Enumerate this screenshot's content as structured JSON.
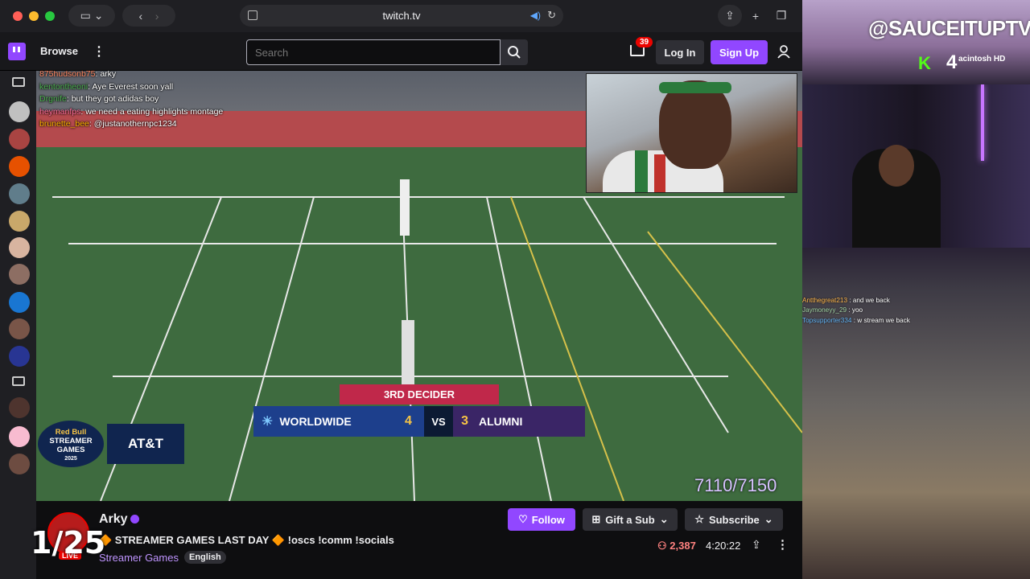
{
  "browser": {
    "url": "twitch.tv"
  },
  "nav": {
    "browse": "Browse",
    "search_placeholder": "Search",
    "notif_count": "39",
    "login": "Log In",
    "signup": "Sign Up"
  },
  "video": {
    "chat": [
      {
        "user": "875hudsonb75",
        "msg": "arky"
      },
      {
        "user": "kentontheoni",
        "msg": "Aye Everest soon yall"
      },
      {
        "user": "Drgnife",
        "msg": "but they got adidas boy"
      },
      {
        "user": "heymanfps",
        "msg": "we need a eating highlights montage"
      },
      {
        "user": "brunette_bee",
        "msg": "@justanothernpc1234"
      }
    ],
    "scoreboard": {
      "title": "3RD DECIDER",
      "team1": "WORLDWIDE",
      "score1": "4",
      "vs": "VS",
      "score2": "3",
      "team2": "ALUMNI"
    },
    "sponsor": {
      "line1": "Red Bull",
      "line2": "STREAMER",
      "line3": "GAMES",
      "line4": "2025",
      "partner": "AT&T"
    },
    "progress_text": "7110/7150"
  },
  "channel": {
    "name": "Arky",
    "title": "🔶 STREAMER GAMES LAST DAY 🔶 !oscs !comm !socials",
    "category": "Streamer Games",
    "language": "English",
    "live": "LIVE",
    "follow": "Follow",
    "gift": "Gift a Sub",
    "subscribe": "Subscribe",
    "viewers": "2,387",
    "uptime": "4:20:22",
    "counter": "1/25"
  },
  "overlay": {
    "handle": "@SAUCEITUPTV",
    "kick_label": "K",
    "kick_count": "4",
    "hd_text": "acintosh HD",
    "chat": [
      {
        "user": "Antthegreat213",
        "msg": "and we back"
      },
      {
        "user": "Jaymoneyy_29",
        "msg": "yoo"
      },
      {
        "user": "Topsupporter334",
        "msg": "w stream we back"
      }
    ]
  },
  "colors": {
    "twitch_purple": "#9147ff",
    "live_red": "#eb0400",
    "kick_green": "#53fc18"
  }
}
